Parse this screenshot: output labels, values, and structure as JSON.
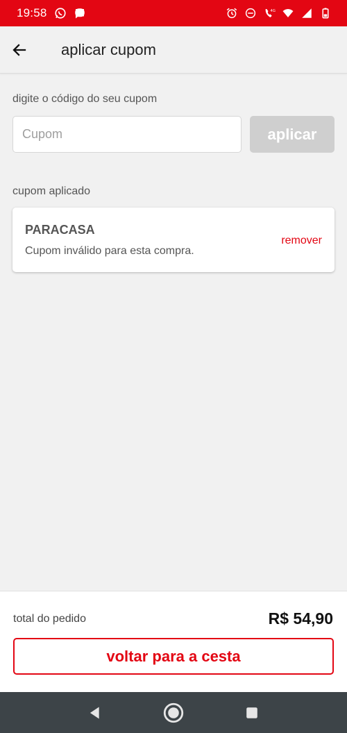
{
  "status_bar": {
    "time": "19:58",
    "background": "#e30613"
  },
  "app_bar": {
    "title": "aplicar cupom"
  },
  "coupon_entry": {
    "label": "digite o código do seu cupom",
    "placeholder": "Cupom",
    "value": "",
    "apply_label": "aplicar"
  },
  "applied": {
    "label": "cupom aplicado",
    "code": "PARACASA",
    "message": "Cupom inválido para esta compra.",
    "remove_label": "remover"
  },
  "footer": {
    "total_label": "total do pedido",
    "total_value": "R$ 54,90",
    "back_button_label": "voltar para a cesta"
  },
  "colors": {
    "accent": "#e30613",
    "disabled_button": "#cfcfcf",
    "nav_bar": "#3d4448"
  },
  "icons": {
    "back": "arrow-left-icon",
    "nav_back": "triangle-back-icon",
    "nav_home": "circle-home-icon",
    "nav_recents": "square-recents-icon"
  }
}
